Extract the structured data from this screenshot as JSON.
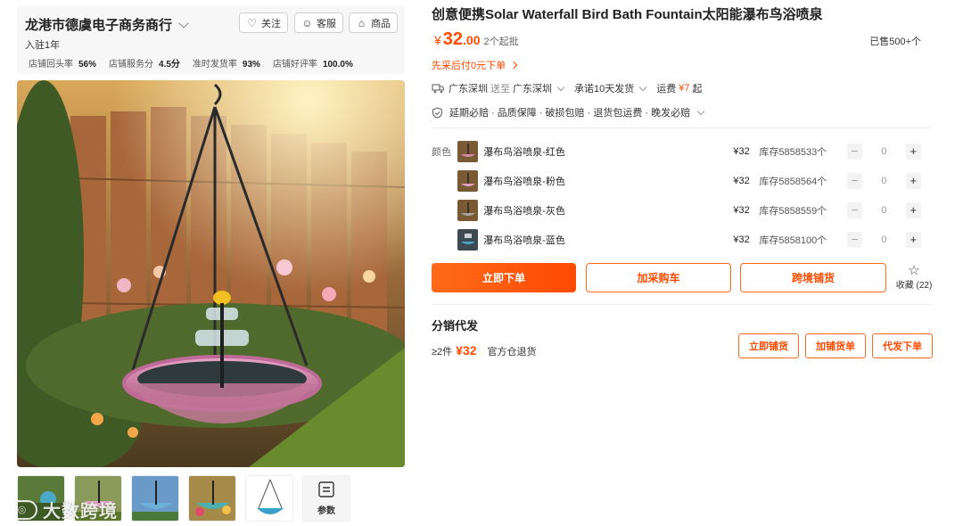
{
  "shop": {
    "name": "龙港市德虞电子商务商行",
    "follow_label": "关注",
    "service_label": "客服",
    "products_label": "商品",
    "years": "入驻1年",
    "stats": [
      {
        "label": "店铺回头率",
        "value": "56%"
      },
      {
        "label": "店铺服务分",
        "value": "4.5分"
      },
      {
        "label": "准时发货率",
        "value": "93%"
      },
      {
        "label": "店铺好评率",
        "value": "100.0%"
      }
    ]
  },
  "gallery": {
    "params_label": "参数",
    "watermark": "大数跨境"
  },
  "product": {
    "title": "创意便携Solar Waterfall Bird Bath Fountain太阳能瀑布鸟浴喷泉",
    "currency": "¥",
    "price_int": "32",
    "price_dec": ".00",
    "moq": "2个起批",
    "sold": "已售500+个",
    "bnpl": "先采后付0元下单"
  },
  "shipping": {
    "from": "广东深圳",
    "to_word": "送至",
    "to": "广东深圳",
    "promise": "承诺10天发货",
    "fee_label": "运费",
    "fee_value": "¥7",
    "fee_suffix": "起"
  },
  "guarantees": "延期必赔 · 品质保障 · 破损包赔 · 退货包运费 · 晚发必赔",
  "sku": {
    "label": "颜色",
    "items": [
      {
        "name": "瀑布鸟浴喷泉-红色",
        "price": "¥32",
        "stock": "库存5858533个",
        "qty": "0",
        "swatch": "#6a5a3a"
      },
      {
        "name": "瀑布鸟浴喷泉-粉色",
        "price": "¥32",
        "stock": "库存5858564个",
        "qty": "0",
        "swatch": "#6a5a3a"
      },
      {
        "name": "瀑布鸟浴喷泉-灰色",
        "price": "¥32",
        "stock": "库存5858559个",
        "qty": "0",
        "swatch": "#6a5a3a"
      },
      {
        "name": "瀑布鸟浴喷泉-蓝色",
        "price": "¥32",
        "stock": "库存5858100个",
        "qty": "0",
        "swatch": "#3a4a55"
      }
    ],
    "minus": "−",
    "plus": "+"
  },
  "actions": {
    "buy_now": "立即下单",
    "add_cart": "加采购车",
    "cross_border": "跨境铺货",
    "favorite": "收藏 (22)"
  },
  "distribution": {
    "title": "分销代发",
    "min_qty": "≥2件",
    "price": "¥32",
    "return_note": "官方仓退货",
    "btn_list": "立即铺货",
    "btn_add": "加铺货单",
    "btn_dropship": "代发下单"
  },
  "colors": {
    "accent": "#ff4a00",
    "accent_light": "#ff6a1a"
  }
}
